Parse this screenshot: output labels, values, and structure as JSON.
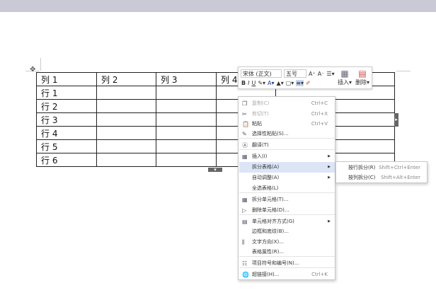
{
  "table": {
    "header": [
      "列 1",
      "列 2",
      "列 3",
      "列 4",
      ""
    ],
    "rows": [
      "行 1",
      "行 2",
      "行 3",
      "行 4",
      "行 5",
      "行 6"
    ]
  },
  "toolbar": {
    "font": "宋体 (正文)",
    "size": "五号",
    "grow": "A⁺",
    "shrink": "A⁻",
    "bold": "B",
    "italic": "I",
    "underline": "U",
    "insert": "插入",
    "delete": "删除"
  },
  "menu": [
    {
      "label": "复制(C)",
      "shortcut": "Ctrl+C",
      "icon": "copy-icon",
      "disabled": true
    },
    {
      "label": "剪切(T)",
      "shortcut": "Ctrl+X",
      "icon": "cut-icon",
      "disabled": true
    },
    {
      "label": "粘贴",
      "shortcut": "Ctrl+V",
      "icon": "paste-icon"
    },
    {
      "label": "选择性粘贴(S)...",
      "icon": "paste-special-icon"
    },
    {
      "label": "翻译(T)",
      "icon": "translate-icon"
    },
    {
      "label": "插入(I)",
      "icon": "insert-table-icon",
      "submenu": true
    },
    {
      "label": "拆分表格(A)",
      "submenu": true,
      "highlighted": true
    },
    {
      "label": "自动调整(A)",
      "submenu": true
    },
    {
      "label": "全选表格(L)"
    },
    {
      "label": "拆分单元格(T)...",
      "icon": "split-cells-icon"
    },
    {
      "label": "删除单元格(D)...",
      "icon": "delete-cells-icon"
    },
    {
      "label": "单元格对齐方式(G)",
      "icon": "cell-align-icon",
      "submenu": true
    },
    {
      "label": "边框和底纹(B)..."
    },
    {
      "label": "文字方向(X)...",
      "icon": "text-direction-icon"
    },
    {
      "label": "表格属性(R)..."
    },
    {
      "label": "项目符号和编号(N)...",
      "icon": "list-icon"
    },
    {
      "label": "超链接(H)...",
      "shortcut": "Ctrl+K",
      "icon": "hyperlink-icon"
    }
  ],
  "submenu": [
    {
      "label": "按行拆分(R)",
      "shortcut": "Shift+Ctrl+Enter"
    },
    {
      "label": "按列拆分(C)",
      "shortcut": "Shift+Alt+Enter"
    }
  ]
}
